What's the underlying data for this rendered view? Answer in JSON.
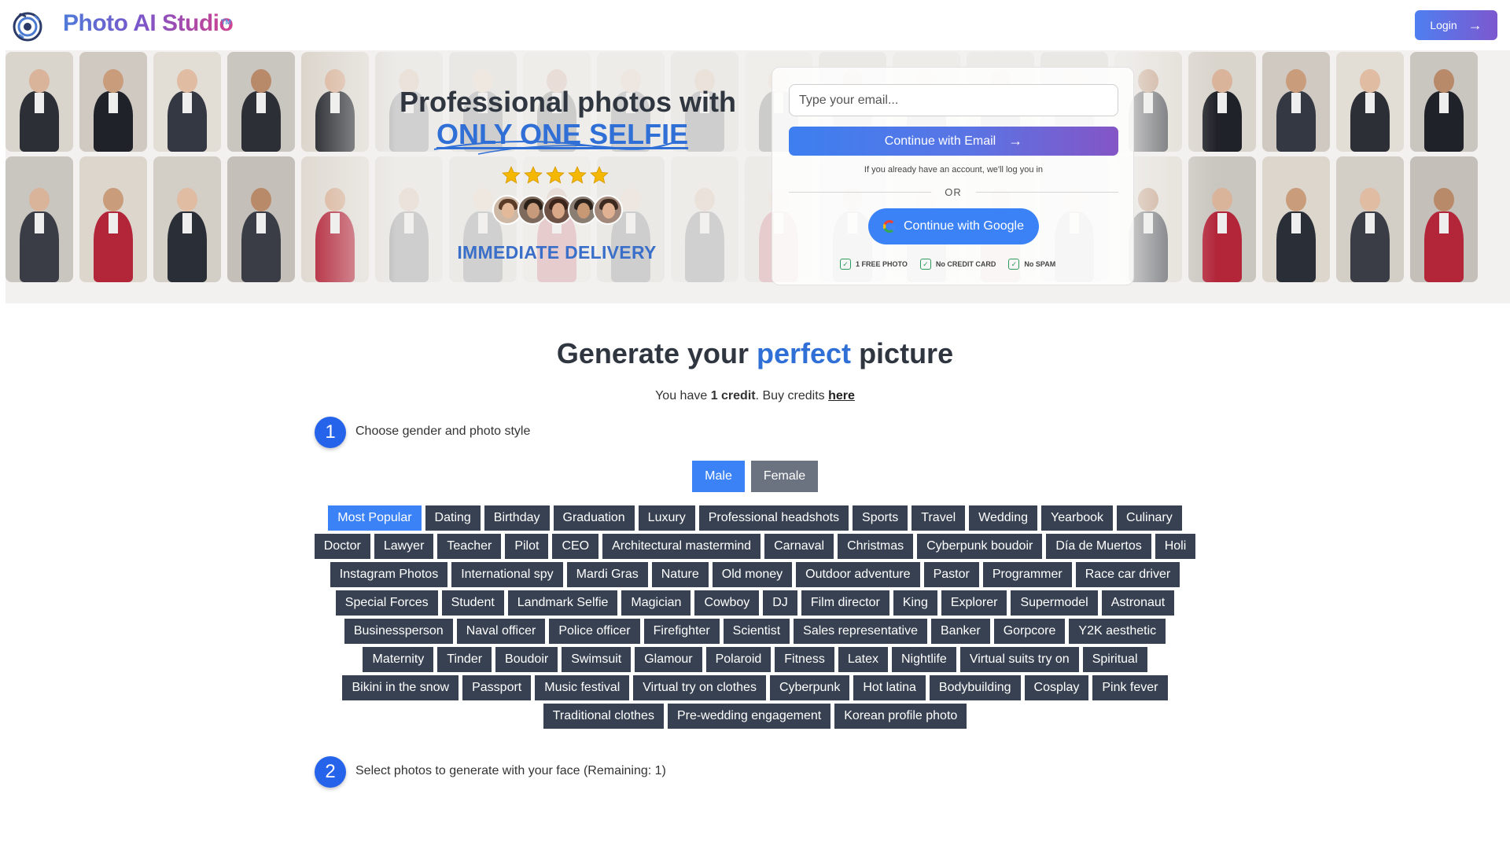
{
  "header": {
    "brand": "Photo AI Studio",
    "trademark": "TM",
    "login_label": "Login",
    "logo_icon": "camera-aperture-icon",
    "colors": {
      "brand_start": "#4f7bd8",
      "brand_end": "#d1428f",
      "login_start": "#4f7ff0",
      "login_end": "#7c58cf"
    }
  },
  "hero": {
    "title_line1": "Professional photos with",
    "title_line2": "ONLY ONE SELFIE",
    "rating_stars": 5,
    "delivery": "IMMEDIATE DELIVERY",
    "signup": {
      "email_placeholder": "Type your email...",
      "email_button": "Continue with Email",
      "login_note": "If you already have an account, we'll log you in",
      "or": "OR",
      "google_button": "Continue with Google",
      "perks": [
        "1 FREE PHOTO",
        "No CREDIT CARD",
        "No SPAM"
      ]
    }
  },
  "generator": {
    "title_before": "Generate your",
    "title_accent": "perfect",
    "title_after": "picture",
    "credit_prefix": "You have",
    "credit_amount": "1 credit",
    "credit_middle": ". Buy credits",
    "credit_link": "here",
    "step1": {
      "number": "1",
      "label": "Choose gender and photo style"
    },
    "genders": [
      {
        "label": "Male",
        "selected": true
      },
      {
        "label": "Female",
        "selected": false
      }
    ],
    "selected_style": "Most Popular",
    "style_rows": [
      [
        "Most Popular",
        "Dating",
        "Birthday",
        "Graduation",
        "Luxury",
        "Professional headshots",
        "Sports",
        "Travel",
        "Wedding",
        "Yearbook",
        "Culinary"
      ],
      [
        "Doctor",
        "Lawyer",
        "Teacher",
        "Pilot",
        "CEO",
        "Architectural mastermind",
        "Carnaval",
        "Christmas",
        "Cyberpunk boudoir",
        "Día de Muertos",
        "Holi"
      ],
      [
        "Instagram Photos",
        "International spy",
        "Mardi Gras",
        "Nature",
        "Old money",
        "Outdoor adventure",
        "Pastor",
        "Programmer",
        "Race car driver"
      ],
      [
        "Special Forces",
        "Student",
        "Landmark Selfie",
        "Magician",
        "Cowboy",
        "DJ",
        "Film director",
        "King",
        "Explorer",
        "Supermodel",
        "Astronaut"
      ],
      [
        "Businessperson",
        "Naval officer",
        "Police officer",
        "Firefighter",
        "Scientist",
        "Sales representative",
        "Banker",
        "Gorpcore",
        "Y2K aesthetic"
      ],
      [
        "Maternity",
        "Tinder",
        "Boudoir",
        "Swimsuit",
        "Glamour",
        "Polaroid",
        "Fitness",
        "Latex",
        "Nightlife",
        "Virtual suits try on",
        "Spiritual"
      ],
      [
        "Bikini in the snow",
        "Passport",
        "Music festival",
        "Virtual try on clothes",
        "Cyberpunk",
        "Hot latina",
        "Bodybuilding",
        "Cosplay",
        "Pink fever"
      ],
      [
        "Traditional clothes",
        "Pre-wedding engagement",
        "Korean profile photo"
      ]
    ],
    "step2": {
      "number": "2",
      "label": "Select photos to generate with your face (Remaining: 1)"
    },
    "colors": {
      "accent": "#2f6fd6",
      "chip": "#374151",
      "chip_active": "#3b82f6",
      "female": "#6b7280"
    }
  }
}
